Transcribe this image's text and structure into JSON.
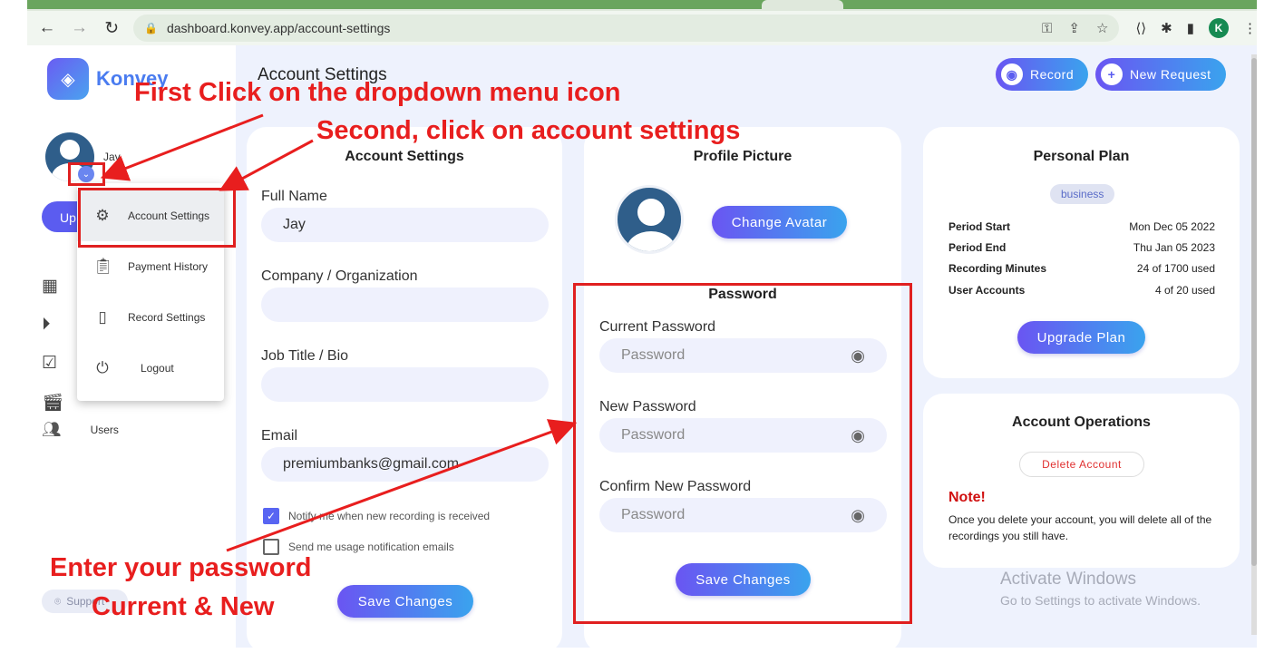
{
  "browser": {
    "url": "dashboard.konvey.app/account-settings",
    "profile_initial": "K"
  },
  "app": {
    "brand": "Konvey",
    "user_name": "Jay",
    "upgrade_partial": "Up",
    "page_title": "Account Settings",
    "record_label": "Record",
    "new_request_label": "New Request",
    "users_label": "Users",
    "support_label": "Support"
  },
  "dropdown": {
    "items": [
      {
        "label": "Account Settings",
        "icon": "gear-icon"
      },
      {
        "label": "Payment History",
        "icon": "clipboard-icon"
      },
      {
        "label": "Record Settings",
        "icon": "device-settings-icon"
      },
      {
        "label": "Logout",
        "icon": "power-icon"
      }
    ]
  },
  "account_card": {
    "title": "Account Settings",
    "full_name_label": "Full Name",
    "full_name_value": "Jay",
    "company_label": "Company / Organization",
    "company_value": "",
    "job_label": "Job Title / Bio",
    "job_value": "",
    "email_label": "Email",
    "email_value": "premiumbanks@gmail.com",
    "notify_label": "Notify me when new recording is received",
    "notify_checked": true,
    "usage_label": "Send me usage notification emails",
    "usage_checked": false,
    "save_label": "Save Changes"
  },
  "profile_card": {
    "title": "Profile Picture",
    "change_avatar_label": "Change Avatar"
  },
  "password_card": {
    "title": "Password",
    "current_label": "Current Password",
    "new_label": "New Password",
    "confirm_label": "Confirm New Password",
    "placeholder": "Password",
    "save_label": "Save Changes"
  },
  "plan_card": {
    "title": "Personal Plan",
    "badge": "business",
    "rows": [
      {
        "key": "Period Start",
        "value": "Mon Dec 05 2022"
      },
      {
        "key": "Period End",
        "value": "Thu Jan 05 2023"
      },
      {
        "key": "Recording Minutes",
        "value": "24 of 1700 used"
      },
      {
        "key": "User Accounts",
        "value": "4 of 20 used"
      }
    ],
    "upgrade_label": "Upgrade Plan"
  },
  "operations_card": {
    "title": "Account Operations",
    "delete_label": "Delete Account",
    "note_title": "Note!",
    "note_text": "Once you delete your account, you will delete all of the recordings you still have."
  },
  "watermark": {
    "line1": "Activate Windows",
    "line2": "Go to Settings to activate Windows."
  },
  "annotations": {
    "step1": "First Click on the dropdown menu icon",
    "step2": "Second, click on account settings",
    "step3_line1": "Enter your password",
    "step3_line2": "Current & New"
  },
  "colors": {
    "accent": "#5b5cf0",
    "annotation": "#e81e1e",
    "danger": "#d01010"
  }
}
